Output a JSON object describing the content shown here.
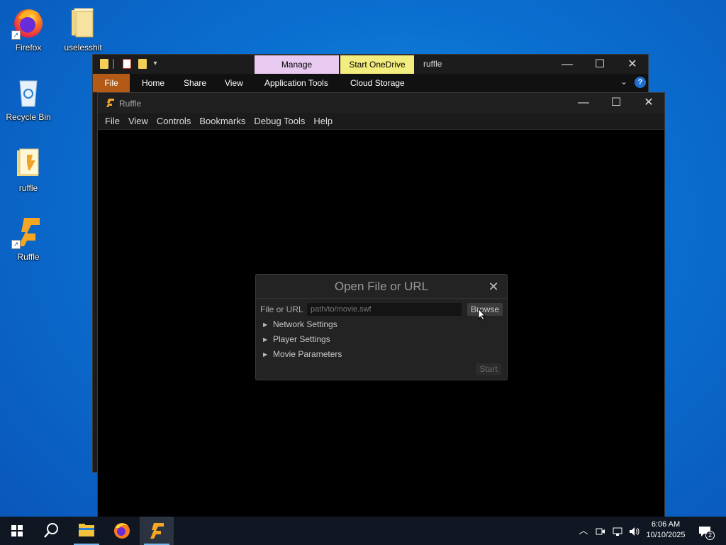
{
  "desktop": {
    "icons": [
      {
        "label": "Firefox",
        "icon": "firefox-icon"
      },
      {
        "label": "uselesshit",
        "icon": "folder-icon"
      },
      {
        "label": "Recycle Bin",
        "icon": "recycle-bin-icon"
      },
      {
        "label": "ruffle",
        "icon": "folder-icon"
      },
      {
        "label": "Ruffle",
        "icon": "ruffle-icon"
      }
    ]
  },
  "explorer": {
    "title": "ruffle",
    "contextual_tabs": {
      "manage": "Manage",
      "start_onedrive": "Start OneDrive"
    },
    "ribbon_tabs": [
      "File",
      "Home",
      "Share",
      "View",
      "Application Tools",
      "Cloud Storage"
    ],
    "colors": {
      "file_tab": "#b35a17",
      "manage": "#e8c9f0",
      "onedrive": "#f3ec7e"
    }
  },
  "ruffle_window": {
    "title": "Ruffle",
    "menu": [
      "File",
      "View",
      "Controls",
      "Bookmarks",
      "Debug Tools",
      "Help"
    ]
  },
  "dialog": {
    "title": "Open File or URL",
    "file_label": "File or URL",
    "input_placeholder": "path/to/movie.swf",
    "browse_label": "Browse",
    "sections": [
      "Network Settings",
      "Player Settings",
      "Movie Parameters"
    ],
    "start_label": "Start"
  },
  "taskbar": {
    "time": "6:06 AM",
    "date": "10/10/2025",
    "notification_count": "2",
    "pinned": [
      "start-icon",
      "search-icon",
      "file-explorer-icon",
      "firefox-icon",
      "ruffle-icon"
    ]
  }
}
